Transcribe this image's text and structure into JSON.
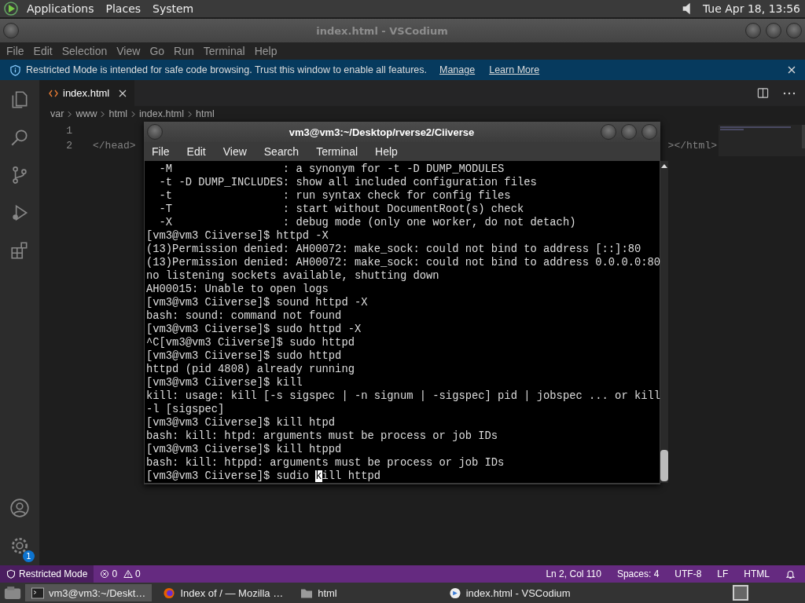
{
  "top_panel": {
    "menus": [
      "Applications",
      "Places",
      "System"
    ],
    "clock": "Tue Apr 18, 13:56"
  },
  "editor_window": {
    "title": "index.html - VSCodium",
    "menu": [
      "File",
      "Edit",
      "Selection",
      "View",
      "Go",
      "Run",
      "Terminal",
      "Help"
    ],
    "notification": {
      "message": "Restricted Mode is intended for safe code browsing. Trust this window to enable all features.",
      "links": [
        "Manage",
        "Learn More"
      ]
    },
    "tabs": [
      {
        "label": "index.html",
        "selected": true
      }
    ],
    "breadcrumbs": [
      "var",
      "www",
      "html",
      "index.html",
      "html"
    ],
    "lines": [
      {
        "number": "1"
      },
      {
        "number": "2",
        "left": "</head>",
        "right": "></html>"
      }
    ],
    "status_bar": {
      "mode": "Restricted Mode",
      "errors": "0",
      "warnings": "0",
      "items": [
        "Ln 2, Col 110",
        "Spaces: 4",
        "UTF-8",
        "LF",
        "HTML"
      ]
    },
    "settings_badge": "1"
  },
  "terminal_window": {
    "title": "vm3@vm3:~/Desktop/rverse2/Ciiverse",
    "menu": [
      "File",
      "Edit",
      "View",
      "Search",
      "Terminal",
      "Help"
    ],
    "lines": [
      "  -M                 : a synonym for -t -D DUMP_MODULES",
      "  -t -D DUMP_INCLUDES: show all included configuration files",
      "  -t                 : run syntax check for config files",
      "  -T                 : start without DocumentRoot(s) check",
      "  -X                 : debug mode (only one worker, do not detach)",
      "[vm3@vm3 Ciiverse]$ httpd -X",
      "(13)Permission denied: AH00072: make_sock: could not bind to address [::]:80",
      "(13)Permission denied: AH00072: make_sock: could not bind to address 0.0.0.0:80",
      "no listening sockets available, shutting down",
      "AH00015: Unable to open logs",
      "[vm3@vm3 Ciiverse]$ sound httpd -X",
      "bash: sound: command not found",
      "[vm3@vm3 Ciiverse]$ sudo httpd -X",
      "^C[vm3@vm3 Ciiverse]$ sudo httpd",
      "[vm3@vm3 Ciiverse]$ sudo httpd",
      "httpd (pid 4808) already running",
      "[vm3@vm3 Ciiverse]$ kill",
      "kill: usage: kill [-s sigspec | -n signum | -sigspec] pid | jobspec ... or kill",
      "-l [sigspec]",
      "[vm3@vm3 Ciiverse]$ kill htpd",
      "bash: kill: htpd: arguments must be process or job IDs",
      "[vm3@vm3 Ciiverse]$ kill htppd",
      "bash: kill: htppd: arguments must be process or job IDs"
    ],
    "input": {
      "before": "[vm3@vm3 Ciiverse]$ sudio ",
      "cursor": "k",
      "after": "ill httpd"
    }
  },
  "taskbar": [
    {
      "label": "vm3@vm3:~/Deskt…",
      "kind": "terminal",
      "selected": true
    },
    {
      "label": "Index of / — Mozilla …",
      "kind": "browser",
      "selected": false
    },
    {
      "label": "html",
      "kind": "folder",
      "selected": false
    },
    {
      "label": "index.html - VSCodium",
      "kind": "editor",
      "selected": false
    }
  ]
}
